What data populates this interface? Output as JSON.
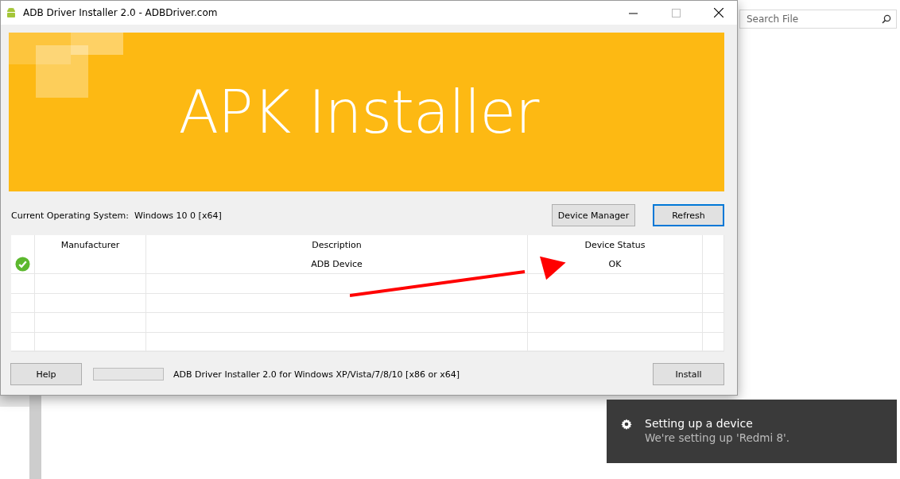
{
  "window": {
    "title": "ADB Driver Installer 2.0 - ADBDriver.com"
  },
  "banner": {
    "title": "APK Installer"
  },
  "os": {
    "label": "Current Operating System:",
    "value": "Windows 10 0 [x64]"
  },
  "top_buttons": [
    {
      "label": "Device Manager",
      "selected": false
    },
    {
      "label": "Refresh",
      "selected": true
    }
  ],
  "table": {
    "columns": [
      "Manufacturer",
      "Description",
      "Device Status"
    ],
    "rows": [
      {
        "ok": true,
        "description": "ADB Device",
        "status": "OK"
      }
    ]
  },
  "bottom": {
    "help": "Help",
    "progress": {
      "level": 0
    },
    "info": "ADB Driver Installer 2.0 for Windows XP/Vista/7/8/10 [x86 or x64]",
    "install": "Install"
  },
  "search": {
    "placeholder": "Search File"
  },
  "toast": {
    "title": "Setting up a device",
    "message": "We're setting up 'Redmi 8'."
  }
}
